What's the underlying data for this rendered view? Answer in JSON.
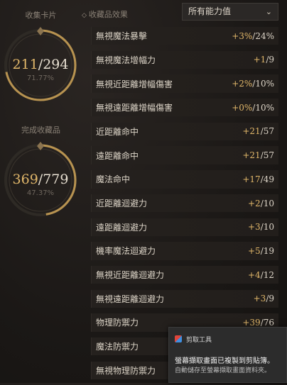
{
  "left_panel": {
    "card_label": "收集卡片",
    "card_count": {
      "current": "211",
      "total": "294",
      "percent": "71.77%",
      "progress": 0.7177
    },
    "completed_label": "完成收藏品",
    "completed_count": {
      "current": "369",
      "total": "779",
      "percent": "47.37%",
      "progress": 0.4737
    }
  },
  "header": {
    "effects_label": "收藏品效果",
    "filter_value": "所有能力值"
  },
  "rows": [
    {
      "name": "無視魔法暴擊",
      "gain": "+3%",
      "total": "/24%"
    },
    {
      "name": "無視魔法增幅力",
      "gain": "+1",
      "total": "/9"
    },
    {
      "name": "無視近距離增幅傷害",
      "gain": "+2%",
      "total": "/10%"
    },
    {
      "name": "無視遠距離增幅傷害",
      "gain": "+0%",
      "total": "/10%"
    },
    {
      "name": "近距離命中",
      "gain": "+21",
      "total": "/57"
    },
    {
      "name": "遠距離命中",
      "gain": "+21",
      "total": "/57"
    },
    {
      "name": "魔法命中",
      "gain": "+17",
      "total": "/49"
    },
    {
      "name": "近距離迴避力",
      "gain": "+2",
      "total": "/10"
    },
    {
      "name": "遠距離迴避力",
      "gain": "+3",
      "total": "/10"
    },
    {
      "name": "機率魔法迴避力",
      "gain": "+5",
      "total": "/19"
    },
    {
      "name": "無視近距離迴避力",
      "gain": "+4",
      "total": "/12"
    },
    {
      "name": "無視遠距離迴避力",
      "gain": "+3",
      "total": "/9"
    },
    {
      "name": "物理防禦力",
      "gain": "+39",
      "total": "/76"
    },
    {
      "name": "魔法防禦力",
      "gain": "",
      "total": ""
    },
    {
      "name": "無視物理防禦力",
      "gain": "",
      "total": ""
    }
  ],
  "toast": {
    "app_name": "剪取工具",
    "line1": "螢幕擷取畫面已複製到剪貼簿。",
    "line2": "自動儲存至螢幕擷取畫面資料夾。"
  },
  "colors": {
    "accent_gold": "#e1b76a",
    "background": "#1b1816"
  }
}
